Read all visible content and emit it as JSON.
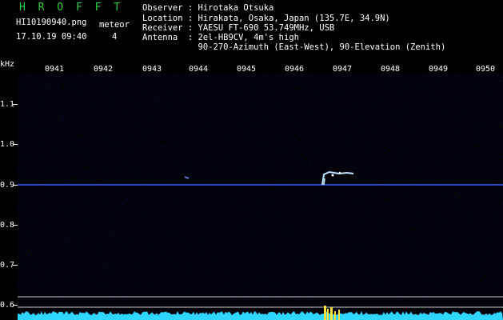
{
  "brand": "H R O F F T",
  "meta": {
    "filename": "HI10190940.png",
    "datetime": "17.10.19 09:40",
    "meteor_label": "meteor",
    "meteor_count": "4"
  },
  "info": {
    "observer": "Observer : Hirotaka Otsuka",
    "location": "Location : Hirakata, Osaka, Japan (135.7E, 34.9N)",
    "receiver": "Receiver : YAESU FT-690 53.749MHz, USB",
    "antenna": "Antenna  : 2el-HB9CV, 4m's high",
    "antenna2": "           90-270-Azimuth (East-West), 90-Elevation (Zenith)"
  },
  "axis": {
    "y_unit": "kHz",
    "x_ticks": [
      "0941",
      "0942",
      "0943",
      "0944",
      "0945",
      "0946",
      "0947",
      "0948",
      "0949",
      "0950"
    ],
    "y_ticks": [
      "1.1",
      "1.0",
      "0.9",
      "0.8",
      "0.7",
      "0.6"
    ]
  },
  "colors": {
    "background": "#000000",
    "brand": "#2ecc40",
    "carrier": "#3a5bff",
    "meteor": "#b8e6ff",
    "baseline": "#2fd6ff",
    "burst": "#ffe23a"
  }
}
